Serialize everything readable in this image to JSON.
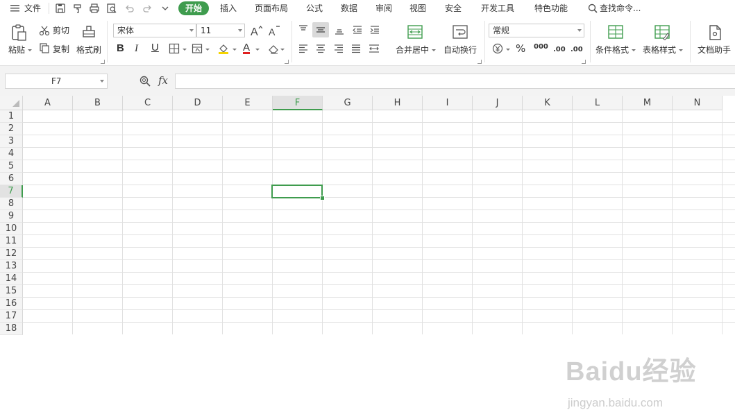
{
  "menubar": {
    "file": "文件",
    "tabs": [
      "开始",
      "插入",
      "页面布局",
      "公式",
      "数据",
      "审阅",
      "视图",
      "安全",
      "开发工具",
      "特色功能"
    ],
    "search": "查找命令..."
  },
  "ribbon": {
    "paste": "粘贴",
    "cut": "剪切",
    "copy": "复制",
    "format_painter": "格式刷",
    "font_name": "宋体",
    "font_size": "11",
    "merge_center": "合并居中",
    "wrap_text": "自动换行",
    "number_format": "常规",
    "percent": "%",
    "thousands": "000",
    "inc_decimal": ".00",
    "dec_decimal": ".00",
    "conditional_format": "条件格式",
    "table_style": "表格样式",
    "doc_helper": "文档助手",
    "bold": "B",
    "italic": "I",
    "underline": "U",
    "font_color": "A"
  },
  "formula_bar": {
    "name_box": "F7",
    "fx": "fx",
    "value": ""
  },
  "grid": {
    "columns": [
      "A",
      "B",
      "C",
      "D",
      "E",
      "F",
      "G",
      "H",
      "I",
      "J",
      "K",
      "L",
      "M",
      "N"
    ],
    "rows": [
      "1",
      "2",
      "3",
      "4",
      "5",
      "6",
      "7",
      "8",
      "9",
      "10",
      "11",
      "12",
      "13",
      "14",
      "15",
      "16",
      "17",
      "18"
    ],
    "selected_column": "F",
    "selected_row": "7"
  },
  "watermark": {
    "logo": "Baidu经验",
    "url": "jingyan.baidu.com"
  },
  "colors": {
    "accent": "#3f9c4e",
    "font_color_bar": "#e02020",
    "fill_color_bar": "#f5d400"
  }
}
